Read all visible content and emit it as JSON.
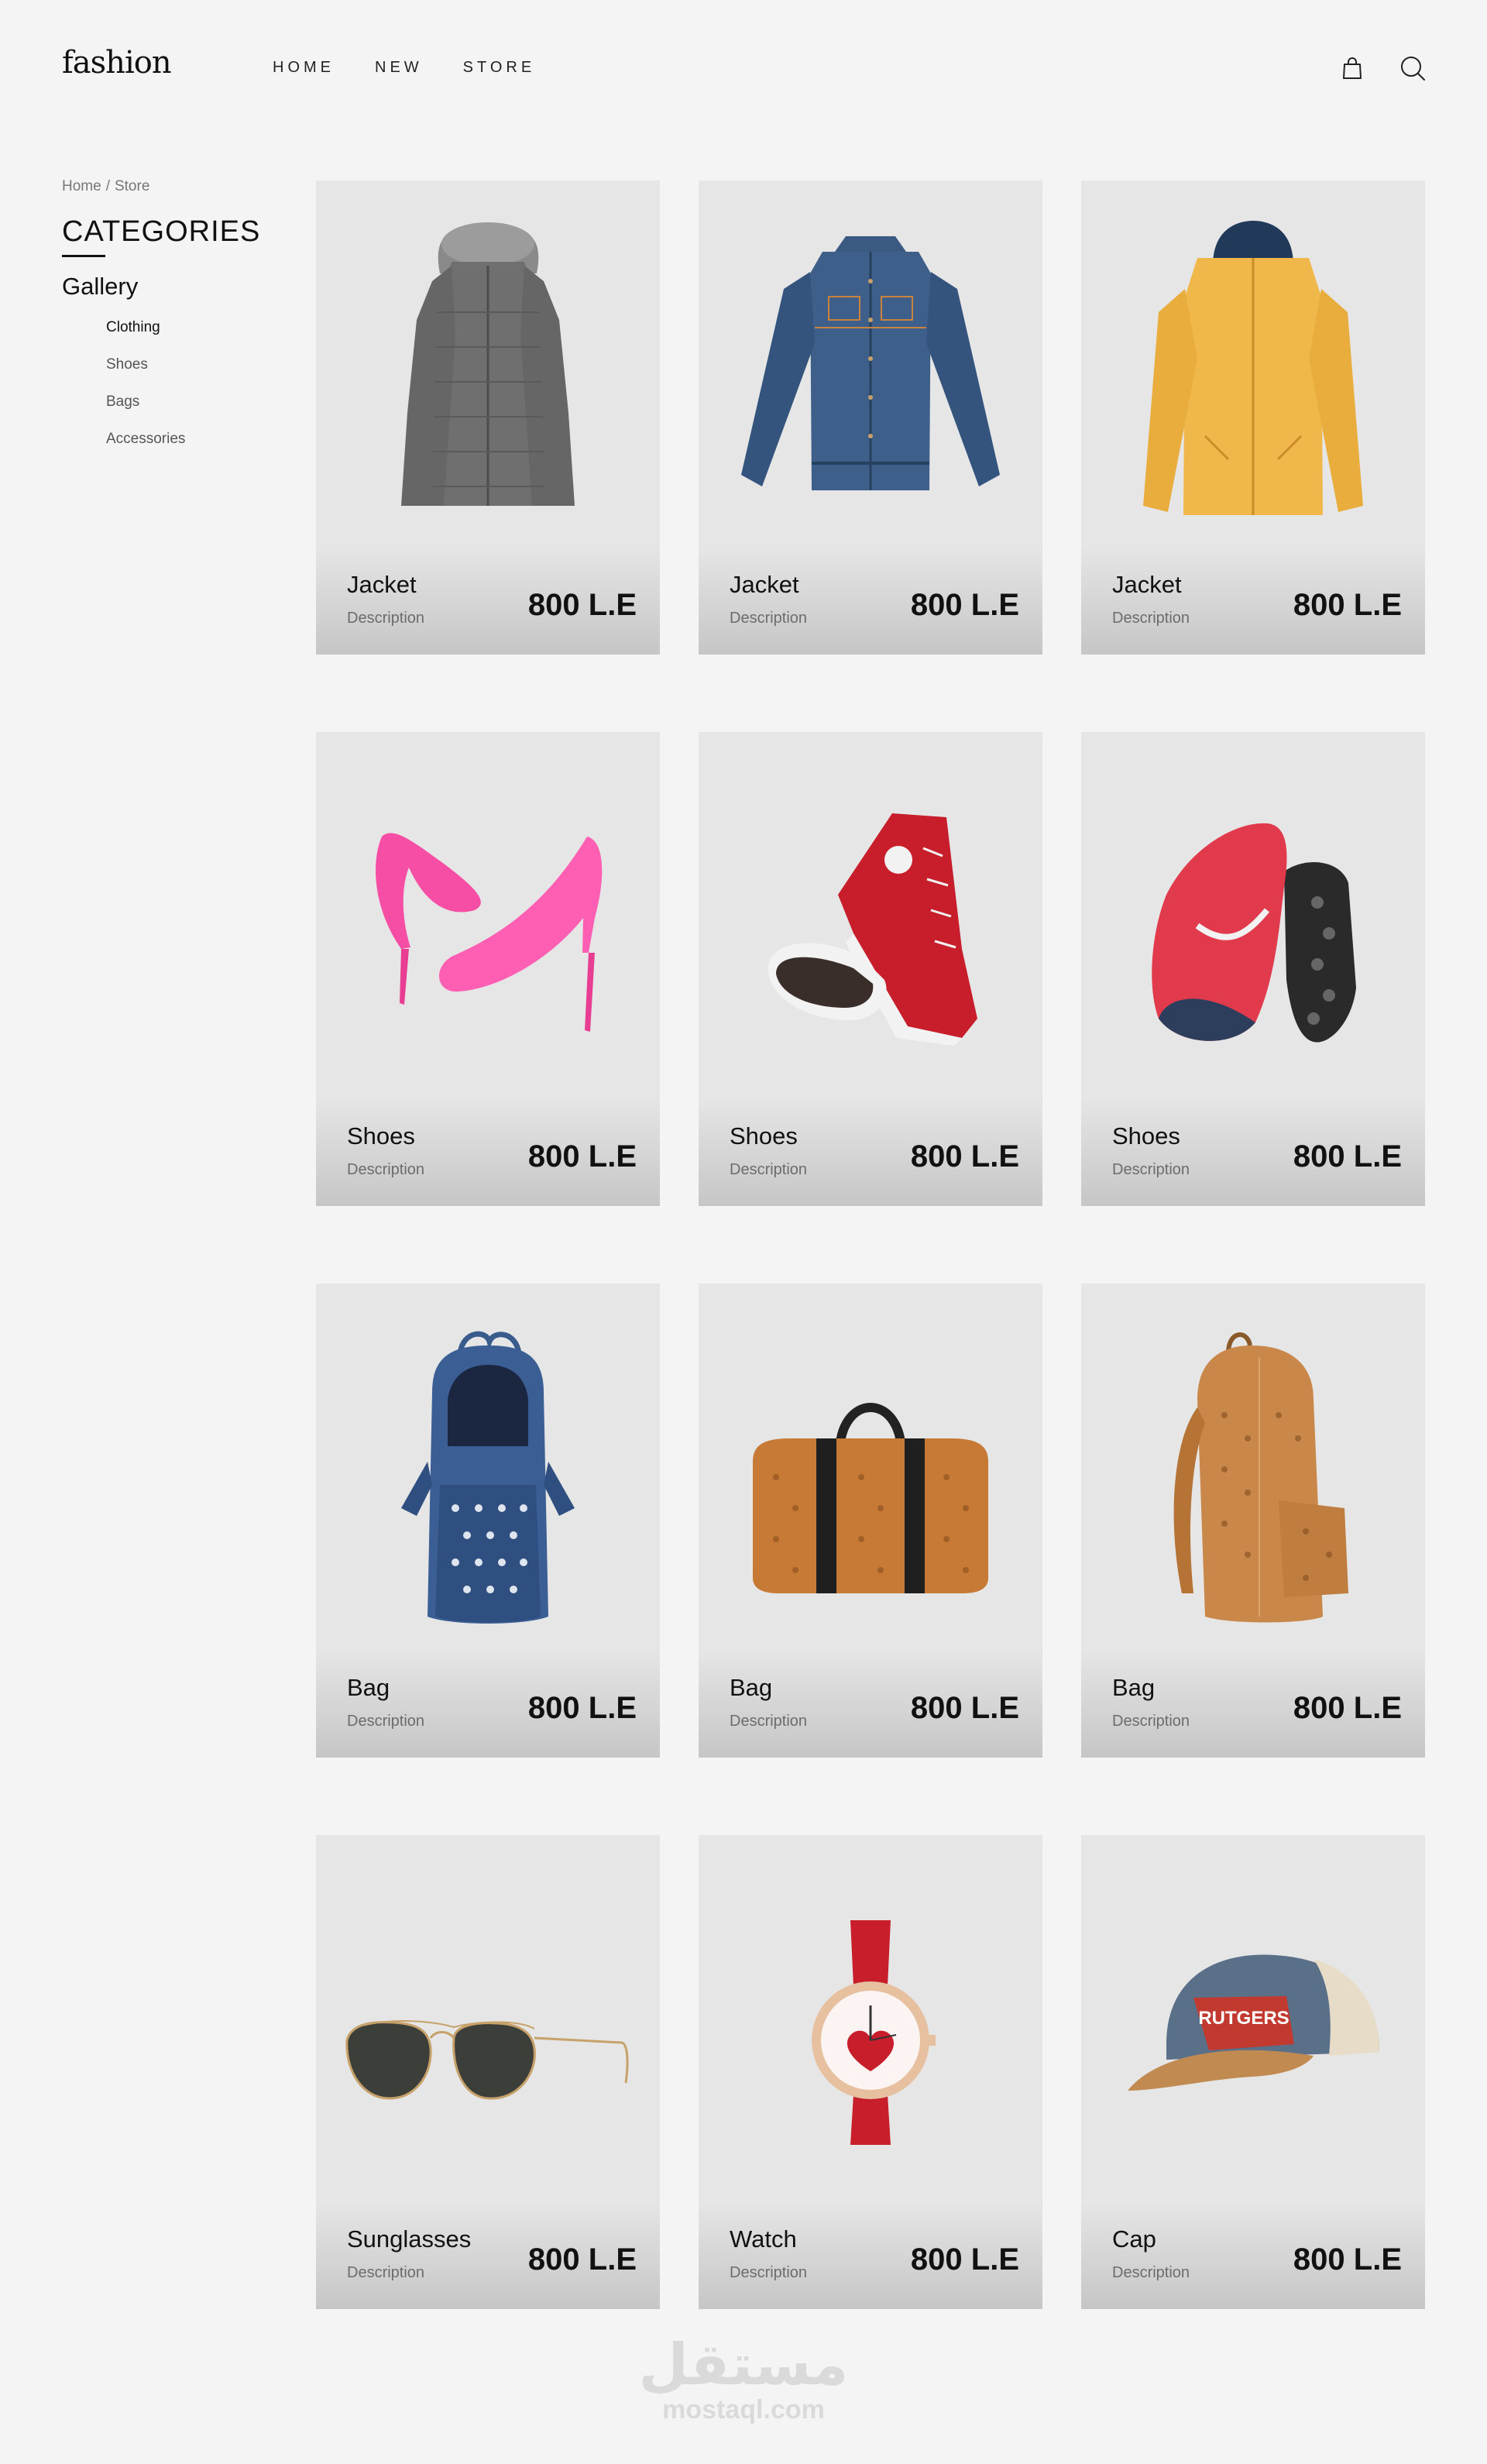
{
  "brand": {
    "logo": "fashion"
  },
  "nav": [
    "HOME",
    "NEW",
    "STORE"
  ],
  "header_icons": [
    "shopping-bag-icon",
    "search-icon"
  ],
  "sidebar": {
    "breadcrumb": [
      "Home",
      "Store"
    ],
    "breadcrumb_separator": "/",
    "title": "CATEGORIES",
    "section": "Gallery",
    "items": [
      "Clothing",
      "Shoes",
      "Bags",
      "Accessories"
    ],
    "active_item": "Clothing"
  },
  "products": [
    {
      "name": "Jacket",
      "description": "Description",
      "price": "800 L.E",
      "image": "grey-puffer-jacket"
    },
    {
      "name": "Jacket",
      "description": "Description",
      "price": "800 L.E",
      "image": "denim-jacket"
    },
    {
      "name": "Jacket",
      "description": "Description",
      "price": "800 L.E",
      "image": "yellow-rain-jacket"
    },
    {
      "name": "Shoes",
      "description": "Description",
      "price": "800 L.E",
      "image": "pink-high-heels"
    },
    {
      "name": "Shoes",
      "description": "Description",
      "price": "800 L.E",
      "image": "red-canvas-sneakers"
    },
    {
      "name": "Shoes",
      "description": "Description",
      "price": "800 L.E",
      "image": "red-running-shoes"
    },
    {
      "name": "Bag",
      "description": "Description",
      "price": "800 L.E",
      "image": "blue-studded-backpack"
    },
    {
      "name": "Bag",
      "description": "Description",
      "price": "800 L.E",
      "image": "brown-duffel-bag"
    },
    {
      "name": "Bag",
      "description": "Description",
      "price": "800 L.E",
      "image": "brown-backpack"
    },
    {
      "name": "Sunglasses",
      "description": "Description",
      "price": "800 L.E",
      "image": "aviator-sunglasses"
    },
    {
      "name": "Watch",
      "description": "Description",
      "price": "800 L.E",
      "image": "red-strap-watch"
    },
    {
      "name": "Cap",
      "description": "Description",
      "price": "800 L.E",
      "image": "trucker-cap",
      "cap_patch_text": "RUTGERS"
    }
  ],
  "watermark": {
    "arabic": "مستقل",
    "url": "mostaql.com"
  },
  "colors": {
    "background": "#f4f4f4",
    "card": "#e6e6e6",
    "text": "#111111"
  }
}
